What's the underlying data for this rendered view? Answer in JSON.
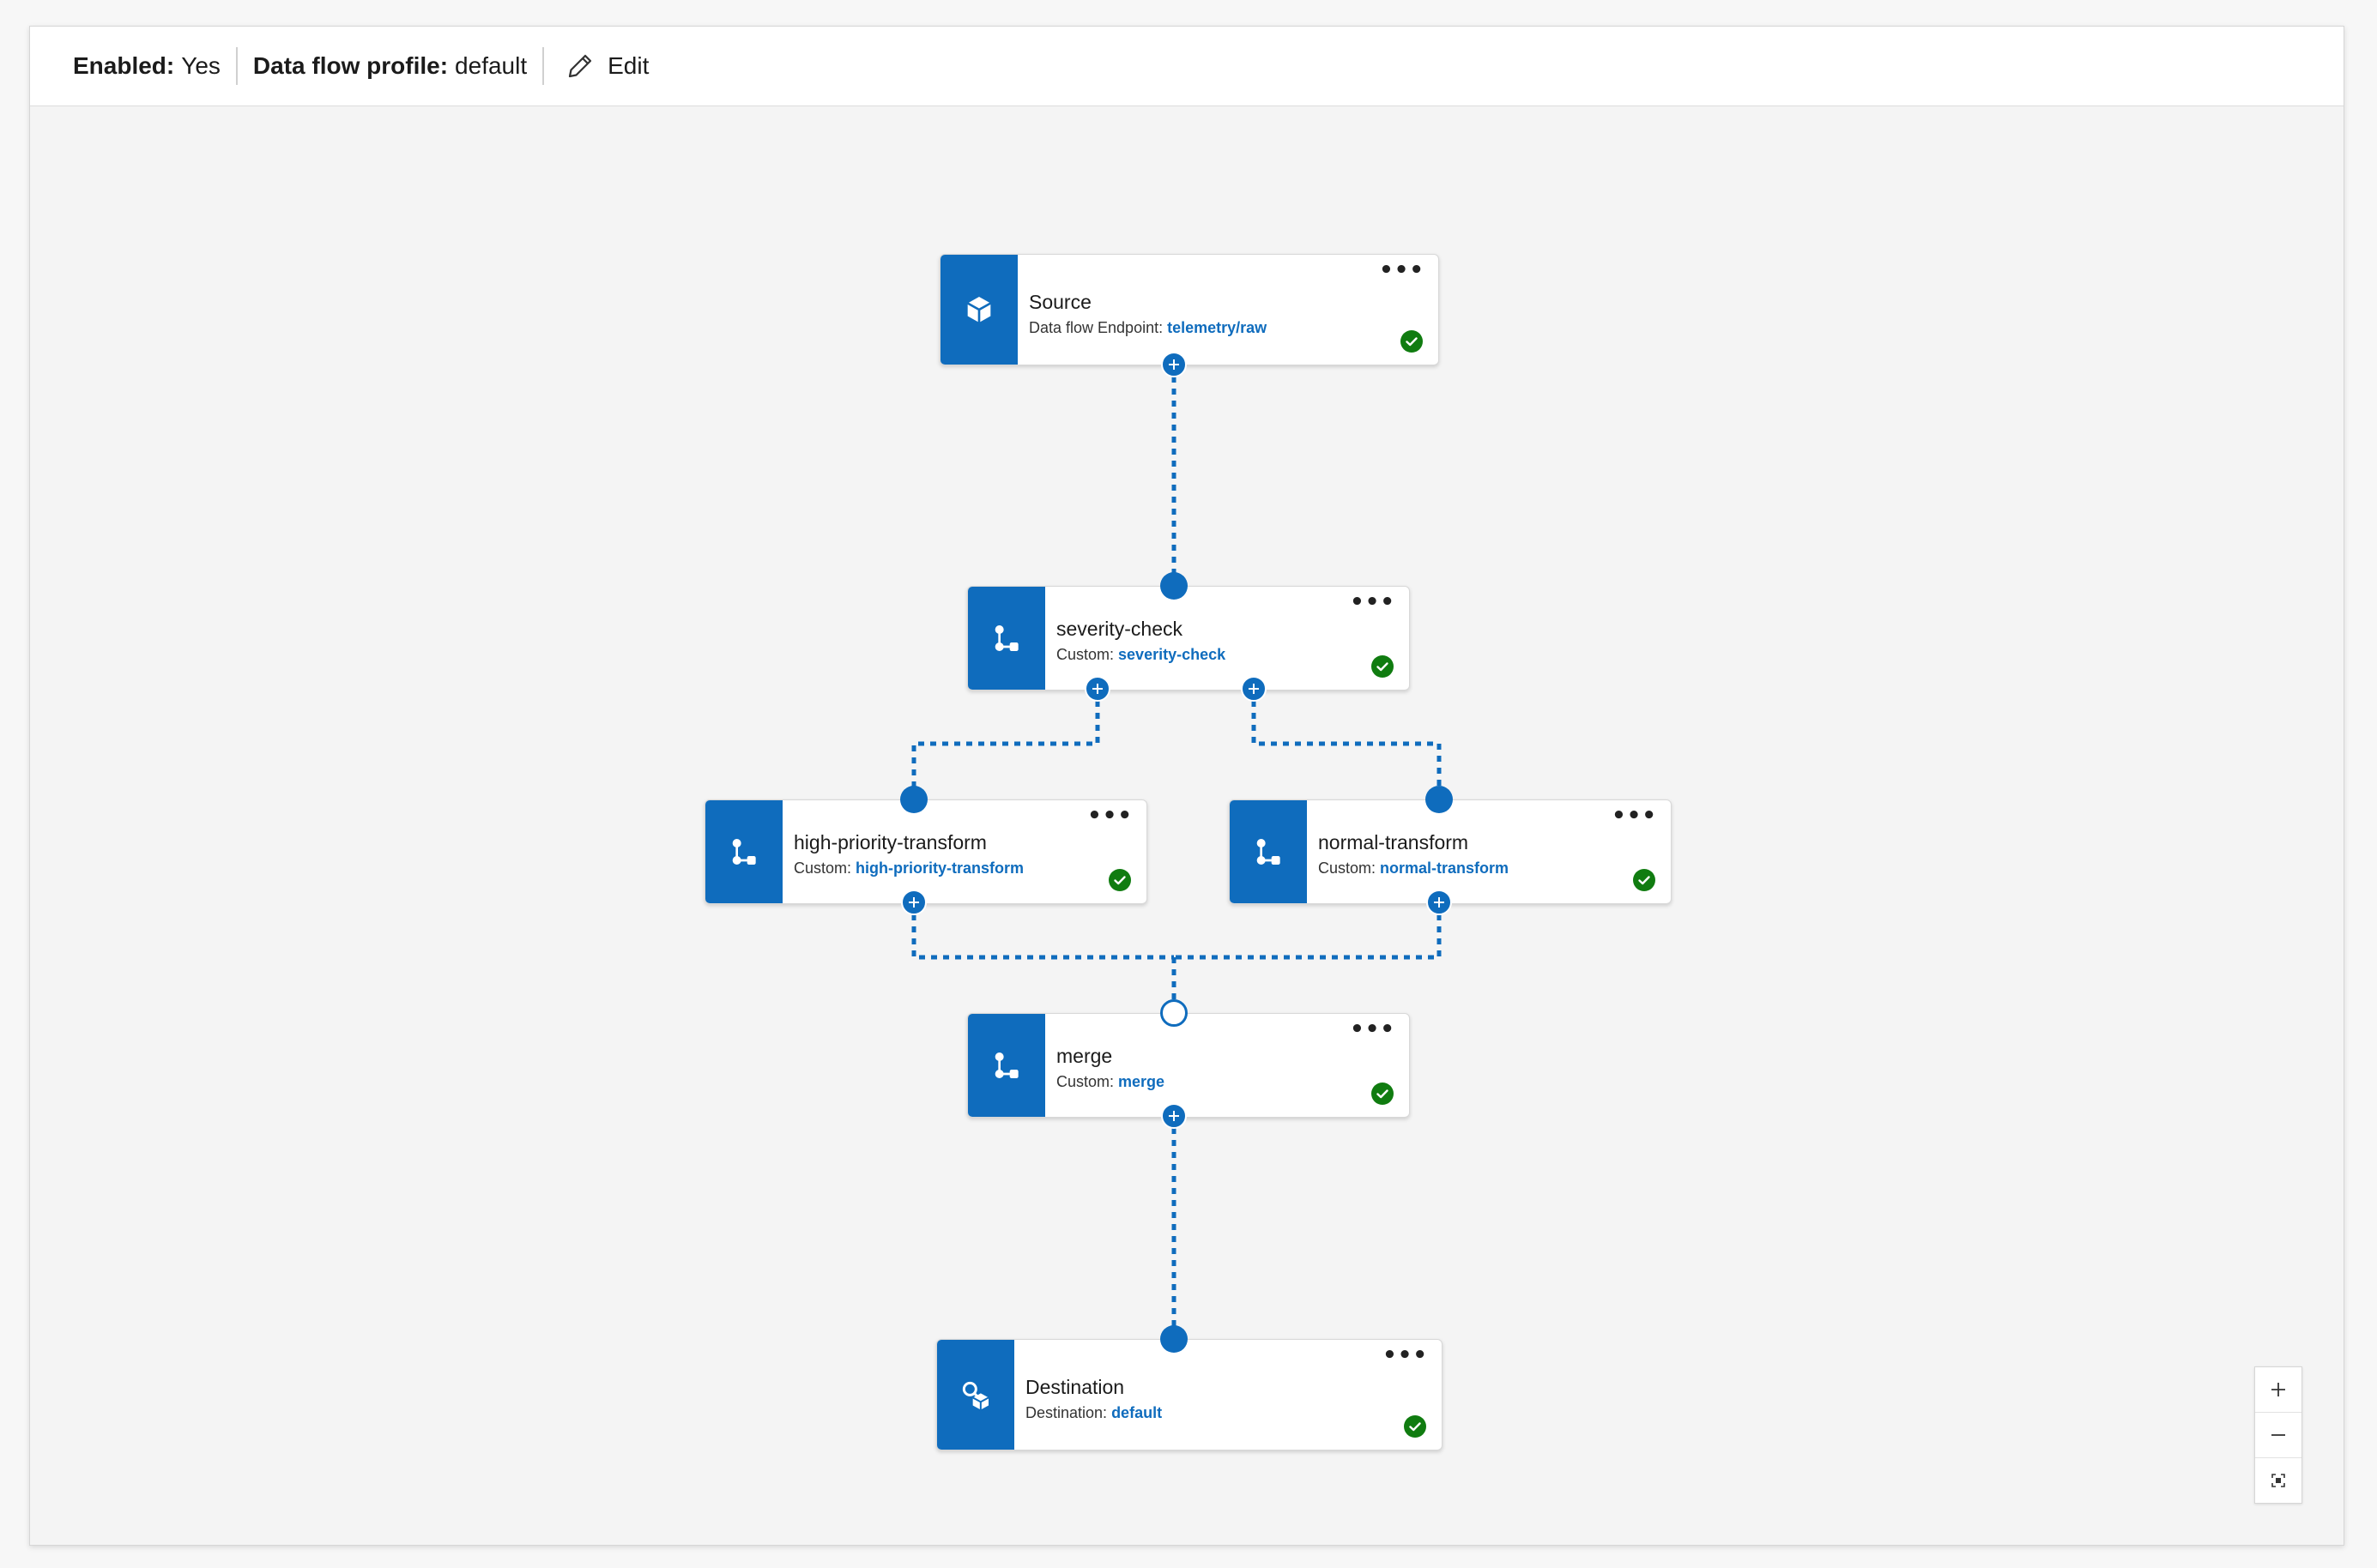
{
  "toolbar": {
    "enabled_label": "Enabled:",
    "enabled_value": "Yes",
    "profile_label": "Data flow profile:",
    "profile_value": "default",
    "edit_label": "Edit"
  },
  "nodes": {
    "source": {
      "title": "Source",
      "sub_label": "Data flow Endpoint:",
      "sub_value": "telemetry/raw",
      "icon": "cube-icon"
    },
    "severity_check": {
      "title": "severity-check",
      "sub_label": "Custom:",
      "sub_value": "severity-check",
      "icon": "branch-icon"
    },
    "high_priority": {
      "title": "high-priority-transform",
      "sub_label": "Custom:",
      "sub_value": "high-priority-transform",
      "icon": "branch-icon"
    },
    "normal": {
      "title": "normal-transform",
      "sub_label": "Custom:",
      "sub_value": "normal-transform",
      "icon": "branch-icon"
    },
    "merge": {
      "title": "merge",
      "sub_label": "Custom:",
      "sub_value": "merge",
      "icon": "branch-icon"
    },
    "destination": {
      "title": "Destination",
      "sub_label": "Destination:",
      "sub_value": "default",
      "icon": "destination-icon"
    }
  },
  "more_label": "•••",
  "colors": {
    "accent": "#0f6cbd",
    "success": "#107c10"
  }
}
